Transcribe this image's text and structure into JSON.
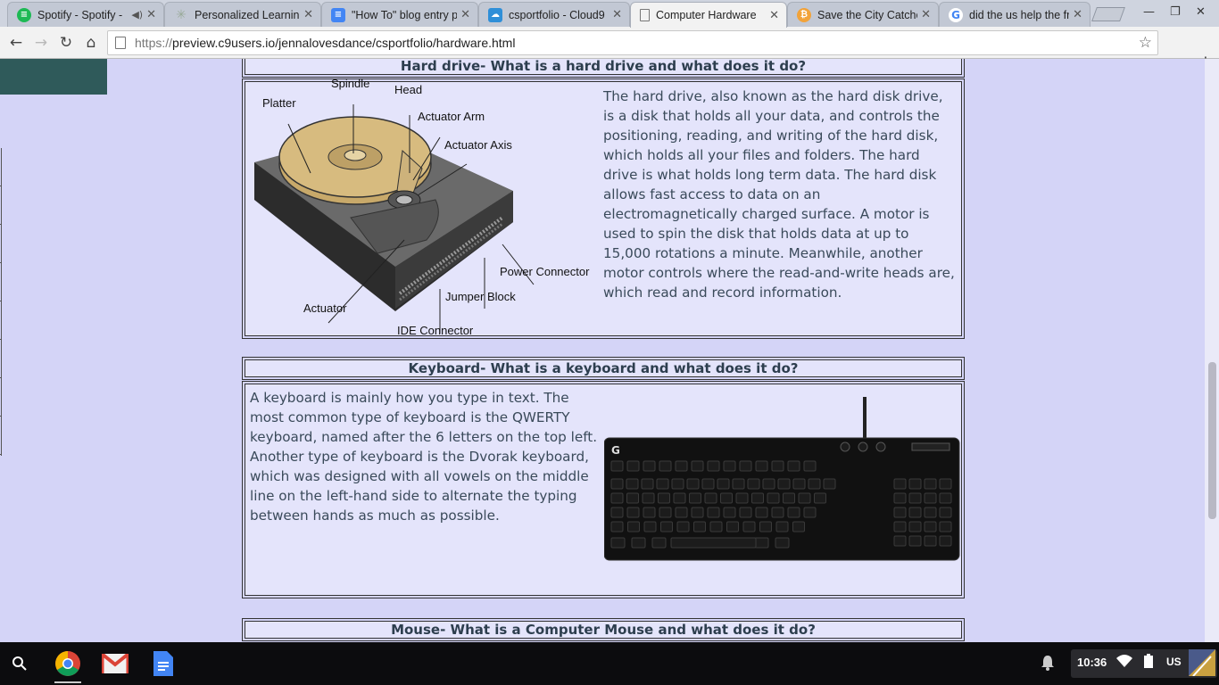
{
  "browser": {
    "tabs": [
      {
        "label": "Spotify - Spotify -",
        "favicon": "spotify-icon",
        "audio": true
      },
      {
        "label": "Personalized Learnin",
        "favicon": "loading-icon"
      },
      {
        "label": "\"How To\" blog entry p",
        "favicon": "docs-icon"
      },
      {
        "label": "csportfolio - Cloud9",
        "favicon": "cloud9-icon"
      },
      {
        "label": "Computer Hardware",
        "favicon": "page-icon",
        "active": true
      },
      {
        "label": "Save the City Catche",
        "favicon": "bitcoin-icon"
      },
      {
        "label": "did the us help the fr",
        "favicon": "google-icon"
      }
    ],
    "url_protocol": "https://",
    "url_rest": "preview.c9users.io/jennalovesdance/csportfolio/hardware.html"
  },
  "sections": {
    "hard_drive": {
      "heading": "Hard drive- What is a hard drive and what does it do?",
      "text": "The hard drive, also known as the hard disk drive, is a disk that holds all your data, and controls the positioning, reading, and writing of the hard disk, which holds all your files and folders. The hard drive is what holds long term data. The hard disk allows fast access to data on an electromagnetically charged surface. A motor is used to spin the disk that holds data at up to 15,000 rotations a minute. Meanwhile, another motor controls where the read-and-write heads are, which read and record information.",
      "diagram_labels": {
        "spindle": "Spindle",
        "head": "Head",
        "platter": "Platter",
        "actuator_arm": "Actuator Arm",
        "actuator_axis": "Actuator Axis",
        "power_connector": "Power Connector",
        "jumper_block": "Jumper Block",
        "actuator": "Actuator",
        "ide_connector": "IDE Connector"
      }
    },
    "keyboard": {
      "heading": "Keyboard- What is a keyboard and what does it do?",
      "text": "A keyboard is mainly how you type in text. The most common type of keyboard is the QWERTY keyboard, named after the 6 letters on the top left. Another type of keyboard is the Dvorak keyboard, which was designed with all vowels on the middle line on the left-hand side to alternate the typing between hands as much as possible."
    },
    "mouse": {
      "heading": "Mouse- What is a Computer Mouse and what does it do?"
    }
  },
  "shelf": {
    "apps": [
      "launcher-search-icon",
      "chrome-icon",
      "gmail-icon",
      "docs-icon"
    ],
    "clock": "10:36",
    "input_method": "US"
  },
  "colors": {
    "page_bg": "#d4d4f7",
    "section_bg": "#e4e4fb",
    "heading_text": "#2d3e4e"
  }
}
